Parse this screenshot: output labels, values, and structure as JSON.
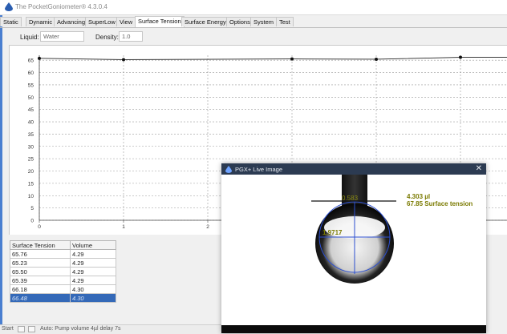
{
  "app": {
    "title": "The PocketGoniometer® 4.3.0.4"
  },
  "tabs": [
    "Static",
    "Dynamic",
    "Advancing",
    "SuperLow",
    "View",
    "Surface Tension",
    "Surface Energy",
    "Options",
    "System",
    "Test"
  ],
  "active_tab": "Surface Tension",
  "liquid": {
    "label": "Liquid:",
    "value": "Water",
    "density_label": "Density:",
    "density_value": "1.0"
  },
  "chart_data": {
    "type": "line",
    "y_ticks": [
      "65",
      "60",
      "55",
      "50",
      "45",
      "40",
      "35",
      "30",
      "25",
      "20",
      "15",
      "10",
      "5",
      "0"
    ],
    "x_ticks": [
      "0",
      "1",
      "2"
    ],
    "ylim": [
      0,
      67
    ],
    "x": [
      0,
      1,
      3,
      4,
      5
    ],
    "series": [
      {
        "values": [
          65.76,
          65.23,
          65.5,
          65.39,
          66.18
        ]
      }
    ],
    "grid": true
  },
  "table": {
    "headers": [
      "Surface Tension",
      "Volume"
    ],
    "rows": [
      [
        "65.76",
        "4.29"
      ],
      [
        "65.23",
        "4.29"
      ],
      [
        "65.50",
        "4.29"
      ],
      [
        "65.39",
        "4.29"
      ],
      [
        "66.18",
        "4.30"
      ],
      [
        "66.48",
        "4.30"
      ]
    ],
    "selected_row": 5
  },
  "live_image": {
    "title": "PGX+ Live Image",
    "close": "✕",
    "top_measure": "0.583",
    "width_measure": "1.9717",
    "volume_text": "4.303 µl",
    "tension_text": "67.85 Surface tension"
  },
  "status": {
    "start": "Start",
    "text": "Auto: Pump volume 4µl   delay 7s"
  },
  "colors": {
    "accent": "#3469b8",
    "popup_title": "#2c3b52",
    "annotation": "#7a7a00"
  }
}
